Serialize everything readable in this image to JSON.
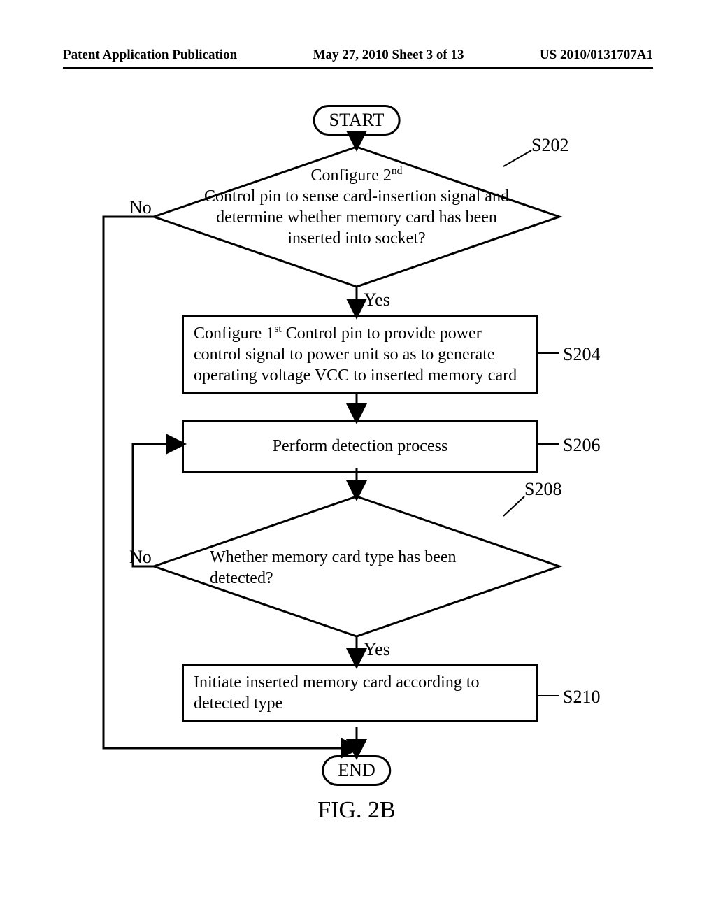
{
  "header": {
    "left": "Patent Application Publication",
    "center": "May 27, 2010  Sheet 3 of 13",
    "right": "US 2010/0131707A1"
  },
  "flow": {
    "start": "START",
    "end": "END",
    "s202_ref": "S202",
    "s202_pre": "Configure 2",
    "s202_sup": "nd",
    "s202_rest": "Control pin to sense card-insertion signal and determine whether memory card has been inserted into socket?",
    "s204_ref": "S204",
    "s204_pre": "Configure 1",
    "s204_sup": "st",
    "s204_rest": " Control pin to provide power control signal to power unit so as to generate operating voltage VCC to inserted memory card",
    "s206_ref": "S206",
    "s206": "Perform detection process",
    "s208_ref": "S208",
    "s208": "Whether memory card type has been detected?",
    "s210_ref": "S210",
    "s210": "Initiate inserted memory card according to detected type",
    "yes1": "Yes",
    "yes2": "Yes",
    "no1": "No",
    "no2": "No",
    "figure": "FIG.  2B"
  }
}
